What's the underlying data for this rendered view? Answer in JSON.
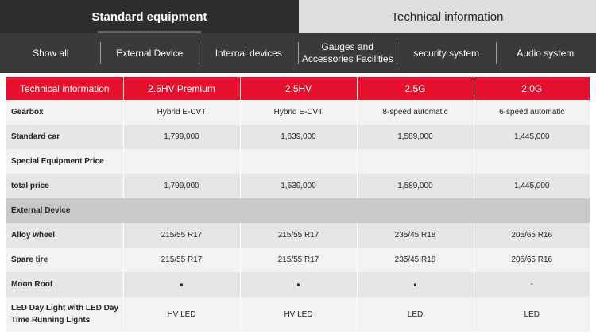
{
  "top_tabs": [
    {
      "label": "Standard equipment"
    },
    {
      "label": "Technical information"
    }
  ],
  "subnav": [
    {
      "label": "Show all"
    },
    {
      "label": "External Device"
    },
    {
      "label": "Internal devices"
    },
    {
      "label": "Gauges and Accessories Facilities"
    },
    {
      "label": "security system"
    },
    {
      "label": "Audio system"
    }
  ],
  "table": {
    "headers": [
      "Technical information",
      "2.5HV Premium",
      "2.5HV",
      "2.5G",
      "2.0G"
    ],
    "rows": [
      {
        "cells": [
          "Gearbox",
          "Hybrid E-CVT",
          "Hybrid E-CVT",
          "8-speed automatic",
          "6-speed automatic"
        ]
      },
      {
        "cells": [
          "Standard car",
          "1,799,000",
          "1,639,000",
          "1,589,000",
          "1,445,000"
        ]
      },
      {
        "cells": [
          "Special Equipment Price",
          "",
          "",
          "",
          ""
        ]
      },
      {
        "cells": [
          "total price",
          "1,799,000",
          "1,639,000",
          "1,589,000",
          "1,445,000"
        ]
      },
      {
        "section": "External Device"
      },
      {
        "cells": [
          "Alloy wheel",
          "215/55 R17",
          "215/55 R17",
          "235/45 R18",
          "205/65 R16"
        ]
      },
      {
        "cells": [
          "Spare tire",
          "215/55 R17",
          "215/55 R17",
          "235/45 R18",
          "205/65 R16"
        ]
      },
      {
        "cells": [
          "Moon Roof",
          "•",
          "•",
          "•",
          "-"
        ]
      },
      {
        "cells": [
          "LED Day Light with LED Day Time Running Lights",
          "HV LED",
          "HV LED",
          "LED",
          "LED"
        ]
      }
    ]
  },
  "colors": {
    "accent": "#e8112d",
    "nav_bg": "#3a3a3a",
    "tab_active": "#2e2e2e"
  }
}
